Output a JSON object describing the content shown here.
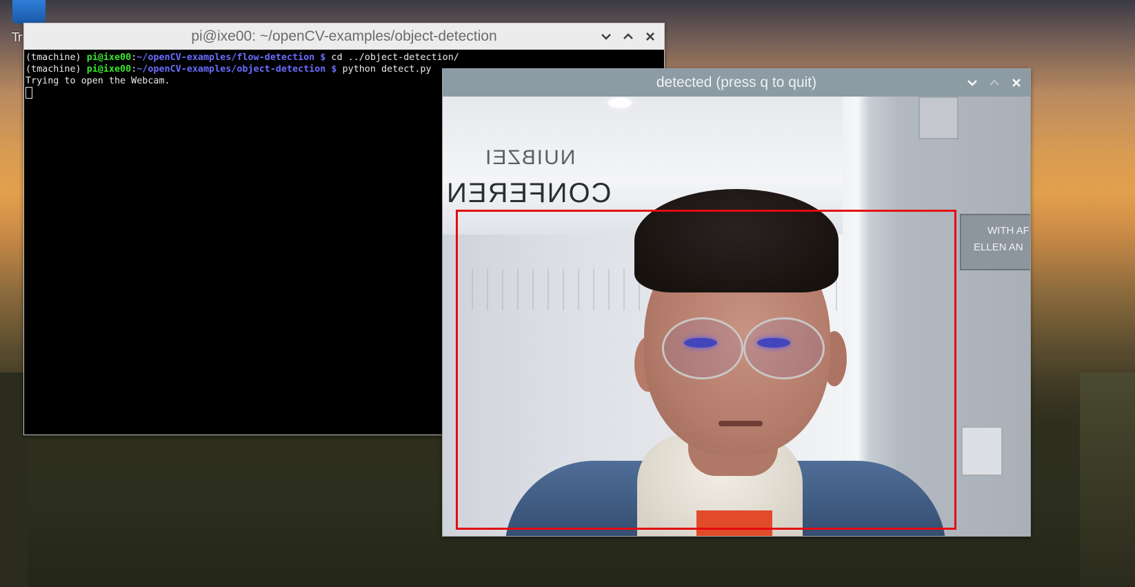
{
  "desktop": {
    "icon_label": "Tr"
  },
  "terminal": {
    "title": "pi@ixe00: ~/openCV-examples/object-detection",
    "lines": [
      {
        "env": "(tmachine) ",
        "userhost": "pi@ixe00",
        "sep": ":",
        "path": "~/openCV-examples/flow-detection $",
        "cmd": " cd ../object-detection/"
      },
      {
        "env": "(tmachine) ",
        "userhost": "pi@ixe00",
        "sep": ":",
        "path": "~/openCV-examples/object-detection $",
        "cmd": " python detect.py"
      }
    ],
    "output": "Trying to open the Webcam."
  },
  "detect_window": {
    "title": "detected (press q to quit)",
    "scene_text": {
      "mirrored_top": "NUIBZEI",
      "mirrored_main": "CONFEREN",
      "sign_line1": "WITH AF",
      "sign_line2": "ELLEN AN"
    }
  },
  "colors": {
    "terminal_bg": "#000000",
    "prompt_green": "#39e62f",
    "path_blue": "#6a6dff",
    "bbox_red": "#e40a12",
    "detect_titlebar": "#8c9ba4"
  },
  "icons": {
    "minimize": "chevron-down-icon",
    "maximize": "chevron-up-icon",
    "close": "close-icon"
  }
}
